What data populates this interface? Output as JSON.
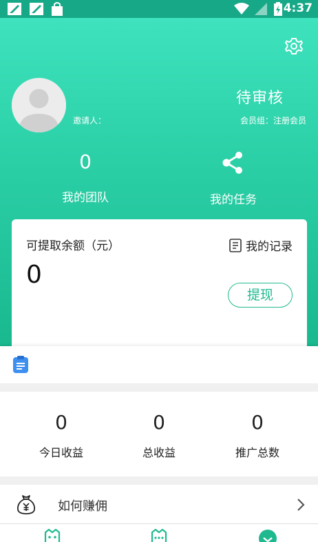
{
  "status_bar": {
    "time": "4:37"
  },
  "profile": {
    "inviter_label": "邀请人：",
    "status": "待审核",
    "member_group": "会员组：注册会员"
  },
  "team": {
    "count": "0",
    "label": "我的团队"
  },
  "tasks": {
    "label": "我的任务"
  },
  "balance": {
    "label": "可提取余额（元）",
    "value": "0",
    "records_label": "我的记录",
    "withdraw_label": "提现"
  },
  "stats": [
    {
      "value": "0",
      "label": "今日收益"
    },
    {
      "value": "0",
      "label": "总收益"
    },
    {
      "value": "0",
      "label": "推广总数"
    }
  ],
  "menu": {
    "earn_label": "如何赚佣"
  },
  "colors": {
    "brand": "#1fb98f",
    "hero_top": "#3ee3be",
    "hero_bottom": "#19b88f"
  }
}
